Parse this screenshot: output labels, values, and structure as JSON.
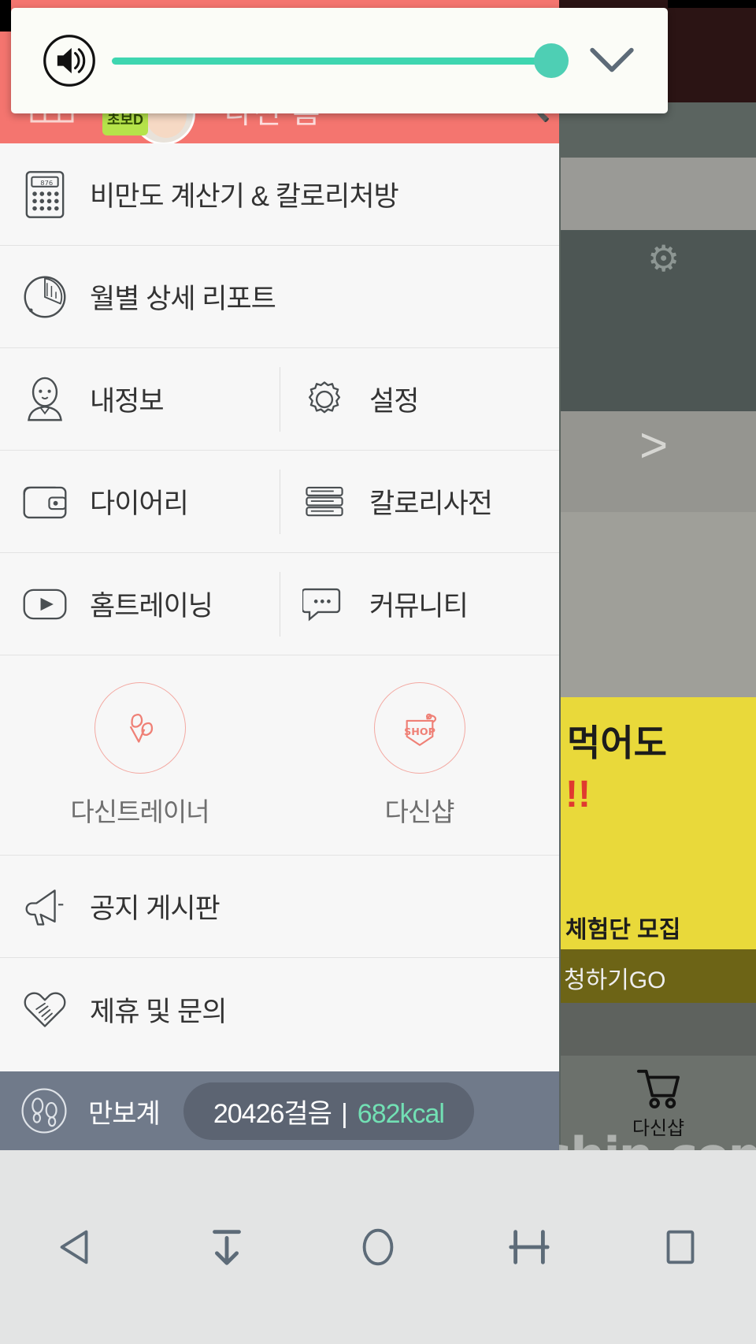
{
  "app": {
    "brand": "dietshin.com",
    "header": {
      "title": "다신 홈",
      "badge_text": "초보D",
      "calendar_icon": "calendar-icon",
      "search_icon": "search-icon",
      "avatar_icon": "avatar-icon"
    }
  },
  "volume_overlay": {
    "speaker_icon": "volume-speaker-icon",
    "collapse_icon": "chevron-down-icon",
    "level_percent": 100,
    "track_color": "#3ed6b0",
    "thumb_color": "#4ecfb4"
  },
  "drawer": {
    "rows": [
      {
        "type": "single",
        "icon": "calculator-icon",
        "label": "비만도 계산기 & 칼로리처방"
      },
      {
        "type": "single",
        "icon": "pie-chart-icon",
        "label": "월별 상세 리포트"
      },
      {
        "type": "dual",
        "left": {
          "icon": "person-icon",
          "label": "내정보"
        },
        "right": {
          "icon": "gear-icon",
          "label": "설정"
        }
      },
      {
        "type": "dual",
        "left": {
          "icon": "wallet-icon",
          "label": "다이어리"
        },
        "right": {
          "icon": "book-stack-icon",
          "label": "칼로리사전"
        }
      },
      {
        "type": "dual",
        "left": {
          "icon": "play-video-icon",
          "label": "홈트레이닝"
        },
        "right": {
          "icon": "chat-bubble-icon",
          "label": "커뮤니티"
        }
      }
    ],
    "promo": {
      "accent_color": "#ef8076",
      "items": [
        {
          "icon": "dumbbell-icon",
          "label": "다신트레이너"
        },
        {
          "icon": "shop-tag-icon",
          "badge_text": "SHOP",
          "label": "다신샵"
        }
      ]
    },
    "footer_rows": [
      {
        "icon": "megaphone-icon",
        "label": "공지 게시판"
      },
      {
        "icon": "handshake-heart-icon",
        "label": "제휴 및 문의"
      }
    ]
  },
  "pedometer": {
    "icon": "footprints-icon",
    "label": "만보계",
    "steps_text": "20426걸음",
    "separator": "|",
    "calories_text": "682kcal",
    "calories_color": "#72e0b4",
    "bar_color": "#707a8a"
  },
  "background": {
    "gear_icon": "gear-icon",
    "chevron_icon": "chevron-right-icon",
    "promo_line1": "먹어도",
    "promo_line2": "!!",
    "promo_line3": "체험단 모집",
    "promo_cta": "청하기GO ",
    "cart_tab": {
      "icon": "cart-icon",
      "label": "다신샵"
    }
  },
  "navbar": {
    "buttons": [
      {
        "icon": "back-triangle-icon",
        "name": "back-button"
      },
      {
        "icon": "download-arrow-icon",
        "name": "download-button"
      },
      {
        "icon": "home-circle-icon",
        "name": "home-button"
      },
      {
        "icon": "collapse-icon",
        "name": "collapse-keyboard-button"
      },
      {
        "icon": "recents-square-icon",
        "name": "recents-button"
      }
    ]
  }
}
